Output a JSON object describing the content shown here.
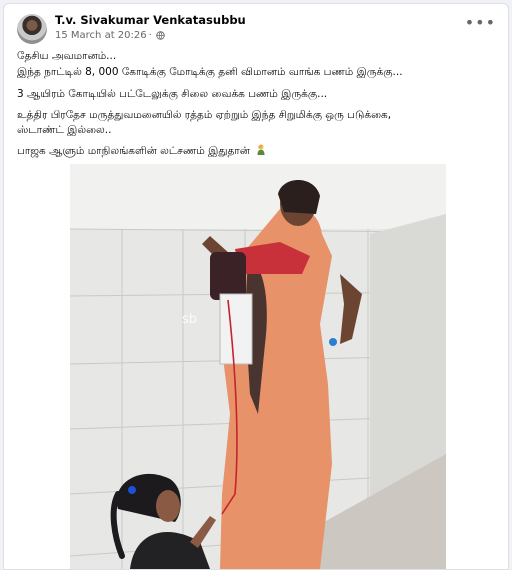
{
  "post": {
    "author": "T.v. Sivakumar Venkatasubbu",
    "timestamp": "15 March at 20:26",
    "separator": "·",
    "privacy_icon": "globe-icon",
    "more_icon": "more-options-icon",
    "lines": [
      "தேசிய அவமானம்...",
      "இந்த நாட்டில் 8, 000 கோடிக்கு மோடிக்கு தனி விமானம் வாங்க பணம் இருக்கு...",
      "3 ஆயிரம் கோடியில் பட்டேலுக்கு சிலை வைக்க பணம் இருக்கு...",
      "உத்திர பிரதேச மருத்துவமனையில் ரத்தம் ஏற்றும் இந்த சிறுமிக்கு ஒரு படுக்கை,",
      "ஸ்டாண்ட் இல்லை..",
      "பாஜக ஆளும் மாநிலங்களின் லட்சணம் இதுதான்"
    ],
    "emoji": "person-facepalming-emoji",
    "image": {
      "watermark": "sb",
      "colors": {
        "saree": "#e8926a",
        "wall": "#e9e9e7",
        "floor": "#cfc9c4"
      }
    }
  }
}
